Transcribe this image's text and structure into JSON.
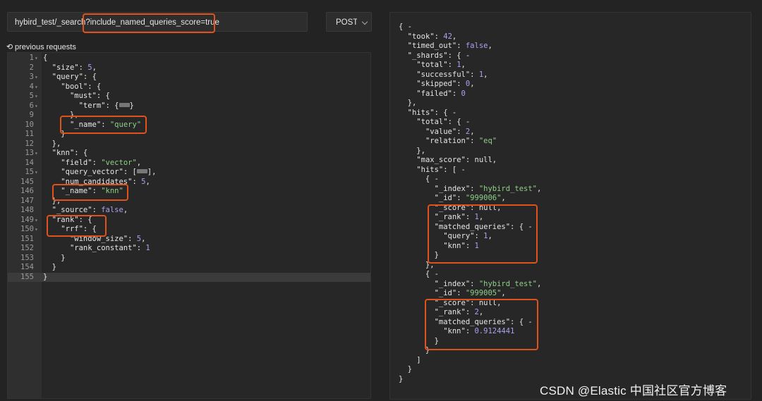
{
  "request": {
    "url": "hybird_test/_search?include_named_queries_score=true",
    "method": "POST"
  },
  "previous_requests_label": "previous requests",
  "editor_lines": [
    {
      "n": "1",
      "fold": true,
      "text": "{"
    },
    {
      "n": "2",
      "text": "  \"size\": 5,"
    },
    {
      "n": "3",
      "fold": true,
      "text": "  \"query\": {"
    },
    {
      "n": "4",
      "fold": true,
      "text": "    \"bool\": {"
    },
    {
      "n": "5",
      "fold": true,
      "text": "      \"must\": {"
    },
    {
      "n": "6",
      "fold": true,
      "text": "        \"term\": {↔}"
    },
    {
      "n": "9",
      "text": "      },"
    },
    {
      "n": "10",
      "text": "      \"_name\": \"query\""
    },
    {
      "n": "11",
      "text": "    }"
    },
    {
      "n": "12",
      "text": "  },"
    },
    {
      "n": "13",
      "fold": true,
      "text": "  \"knn\": {"
    },
    {
      "n": "14",
      "text": "    \"field\": \"vector\","
    },
    {
      "n": "15",
      "fold": true,
      "text": "    \"query_vector\": [↔],"
    },
    {
      "n": "145",
      "text": "    \"num_candidates\": 5,"
    },
    {
      "n": "146",
      "text": "    \"_name\": \"knn\""
    },
    {
      "n": "147",
      "text": "  },"
    },
    {
      "n": "148",
      "text": "  \"_source\": false,"
    },
    {
      "n": "149",
      "fold": true,
      "text": "  \"rank\": {"
    },
    {
      "n": "150",
      "fold": true,
      "text": "    \"rrf\": {"
    },
    {
      "n": "151",
      "text": "      \"window_size\": 5,"
    },
    {
      "n": "152",
      "text": "      \"rank_constant\": 1"
    },
    {
      "n": "153",
      "text": "    }"
    },
    {
      "n": "154",
      "text": "  }"
    },
    {
      "n": "155",
      "text": "}",
      "active": true
    }
  ],
  "response_lines": [
    "{ -",
    "  \"took\": 42,",
    "  \"timed_out\": false,",
    "  \"_shards\": { -",
    "    \"total\": 1,",
    "    \"successful\": 1,",
    "    \"skipped\": 0,",
    "    \"failed\": 0",
    "  },",
    "  \"hits\": { -",
    "    \"total\": { -",
    "      \"value\": 2,",
    "      \"relation\": \"eq\"",
    "    },",
    "    \"max_score\": null,",
    "    \"hits\": [ -",
    "      { -",
    "        \"_index\": \"hybird_test\",",
    "        \"_id\": \"999006\",",
    "        \"_score\": null,",
    "        \"_rank\": 1,",
    "        \"matched_queries\": { -",
    "          \"query\": 1,",
    "          \"knn\": 1",
    "        }",
    "      },",
    "      { -",
    "        \"_index\": \"hybird_test\",",
    "        \"_id\": \"999005\",",
    "        \"_score\": null,",
    "        \"_rank\": 2,",
    "        \"matched_queries\": { -",
    "          \"knn\": 0.9124441",
    "        }",
    "      }",
    "    ]",
    "  }",
    "}"
  ],
  "watermark": "CSDN @Elastic 中国社区官方博客",
  "colors": {
    "annotation": "#e0521b",
    "string": "#8fcf87",
    "number": "#a9a2f0",
    "background": "#232323"
  }
}
